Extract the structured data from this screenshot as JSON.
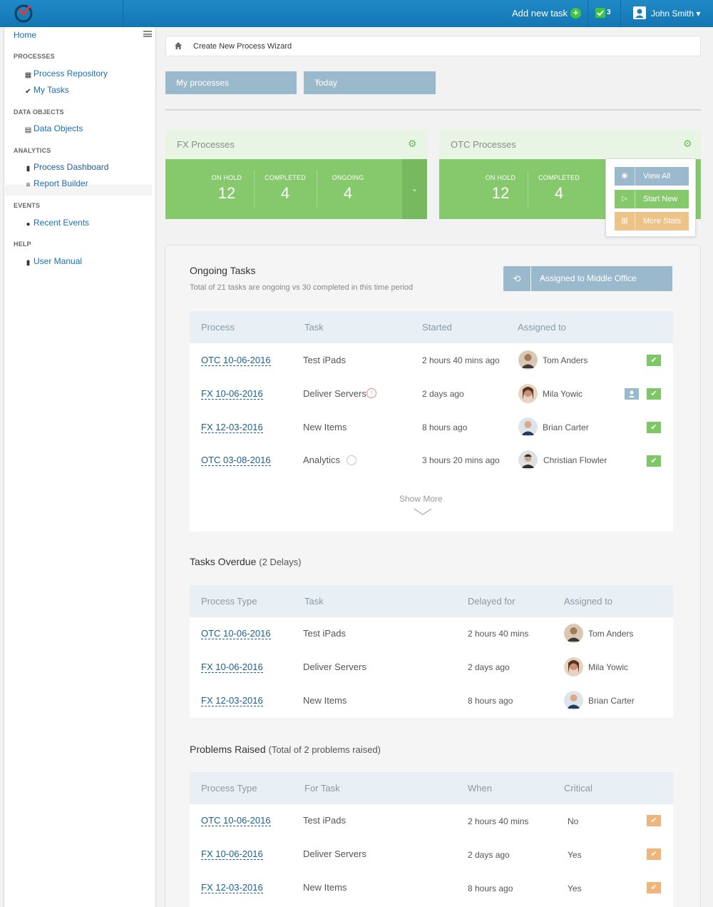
{
  "topbar": {
    "add_task_label": "Add new task",
    "task_count": "3",
    "user_name": "John Smith",
    "colors": {
      "bar": "#1a80bf",
      "accent_green": "#3fc63f"
    }
  },
  "sidebar": {
    "home": "Home",
    "sections": [
      {
        "title": "PROCESSES",
        "items": [
          {
            "label": "Process Repository",
            "icon": "grid-icon"
          },
          {
            "label": "My Tasks",
            "icon": "check-circle-icon"
          }
        ]
      },
      {
        "title": "DATA OBJECTS",
        "items": [
          {
            "label": "Data Objects",
            "icon": "table-icon"
          }
        ]
      },
      {
        "title": "ANALYTICS",
        "items": [
          {
            "label": "Process Dashboard",
            "icon": "bar-chart-icon"
          },
          {
            "label": "Report Builder",
            "icon": "list-icon"
          }
        ]
      },
      {
        "title": "EVENTS",
        "items": [
          {
            "label": "Recent Events",
            "icon": "globe-icon"
          }
        ]
      },
      {
        "title": "HELP",
        "items": [
          {
            "label": "User Manual",
            "icon": "book-icon"
          }
        ]
      }
    ]
  },
  "breadcrumb": {
    "text": "Create New Process Wizard"
  },
  "filters": {
    "process": "My processes",
    "period": "Today"
  },
  "cards": [
    {
      "title": "FX Processes",
      "stats": [
        {
          "label": "ON HOLD",
          "value": "12"
        },
        {
          "label": "COMPLETED",
          "value": "4"
        },
        {
          "label": "ONGOING",
          "value": "4"
        }
      ]
    },
    {
      "title": "OTC Processes",
      "stats": [
        {
          "label": "ON HOLD",
          "value": "12"
        },
        {
          "label": "COMPLETED",
          "value": "4"
        }
      ]
    }
  ],
  "menu": {
    "view_all": "View All",
    "start_new": "Start New",
    "more_stats": "More Stats"
  },
  "ongoing": {
    "title": "Ongoing Tasks",
    "description": "Total of 21 tasks are ongoing vs 30 completed in this time period",
    "assigned_filter": "Assigned to Middle Office",
    "columns": [
      "Process",
      "Task",
      "Started",
      "Assigned to"
    ],
    "rows": [
      {
        "process": "OTC 10-06-2016",
        "task": "Test iPads",
        "started": "2 hours 40 mins ago",
        "assignee": "Tom Anders"
      },
      {
        "process": "FX 10-06-2016",
        "task": "Deliver Servers",
        "started": "2 days ago",
        "assignee": "Mila Yowic"
      },
      {
        "process": "FX 12-03-2016",
        "task": "New Items",
        "started": "8 hours ago",
        "assignee": "Brian Carter"
      },
      {
        "process": "OTC 03-08-2016",
        "task": "Analytics",
        "started": "3 hours 20 mins ago",
        "assignee": "Christian Flowler"
      }
    ],
    "show_more": "Show More"
  },
  "overdue": {
    "title": "Tasks Overdue",
    "subtitle": "(2 Delays)",
    "columns": [
      "Process Type",
      "Task",
      "Delayed for",
      "Assigned to"
    ],
    "rows": [
      {
        "process": "OTC 10-06-2016",
        "task": "Test iPads",
        "delayed": "2 hours 40 mins",
        "assignee": "Tom Anders"
      },
      {
        "process": "FX 10-06-2016",
        "task": "Deliver Servers",
        "delayed": "2 days ago",
        "assignee": "Mila Yowic"
      },
      {
        "process": "FX 12-03-2016",
        "task": "New Items",
        "delayed": "8 hours ago",
        "assignee": "Brian Carter"
      }
    ]
  },
  "problems": {
    "title": "Problems Raised",
    "subtitle": "(Total of 2 problems raised)",
    "columns": [
      "Process Type",
      "For Task",
      "When",
      "Critical"
    ],
    "rows": [
      {
        "process": "OTC 10-06-2016",
        "task": "Test iPads",
        "when": "2 hours 40 mins",
        "critical": "No"
      },
      {
        "process": "FX 10-06-2016",
        "task": "Deliver Servers",
        "when": "2 days ago",
        "critical": "Yes"
      },
      {
        "process": "FX 12-03-2016",
        "task": "New Items",
        "when": "8 hours ago",
        "critical": "Yes"
      }
    ]
  }
}
